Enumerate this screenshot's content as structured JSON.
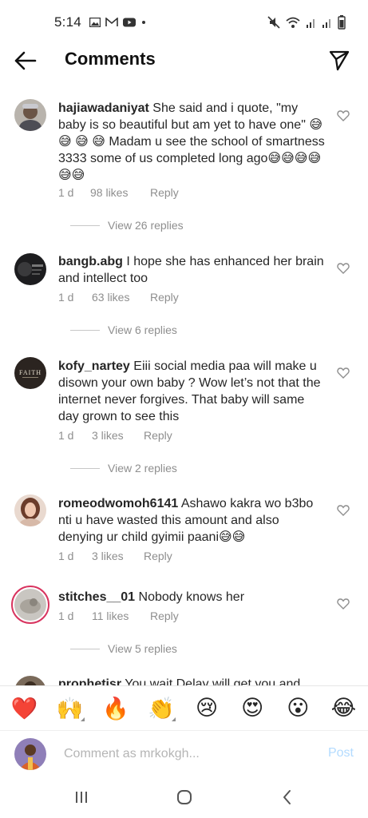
{
  "status_bar": {
    "time": "5:14",
    "left_icons": [
      "gallery-icon",
      "gmail-icon",
      "youtube-icon",
      "dot-icon"
    ],
    "right_icons": [
      "mute-icon",
      "wifi-icon",
      "signal-icon",
      "signal-icon",
      "battery-icon"
    ]
  },
  "header": {
    "title": "Comments",
    "back_icon": "arrow-left-icon",
    "send_icon": "send-icon"
  },
  "comments": [
    {
      "username": "hajiawadaniyat",
      "text": "She said and i quote, \"my baby is so beautiful but am yet to have one\" 😅 😅 😅 😅 Madam u see the school of smartness 3333 some of us completed long ago😅😅😅😅😅😅",
      "time": "1 d",
      "likes": "98 likes",
      "reply": "Reply",
      "view_replies": "View 26 replies"
    },
    {
      "username": "bangb.abg",
      "text": "I hope she has enhanced her brain and intellect too",
      "time": "1 d",
      "likes": "63 likes",
      "reply": "Reply",
      "view_replies": "View 6 replies"
    },
    {
      "username": "kofy_nartey",
      "text": "Eiii social media paa will make u disown your own baby ? Wow let’s not that the internet never forgives. That baby will same day grown to see this",
      "time": "1 d",
      "likes": "3 likes",
      "reply": "Reply",
      "view_replies": "View 2 replies"
    },
    {
      "username": "romeodwomoh6141",
      "text": "Ashawo kakra wo b3bo nti u have wasted this amount and also denying ur child gyimii paani😅😅",
      "time": "1 d",
      "likes": "3 likes",
      "reply": "Reply",
      "view_replies": ""
    },
    {
      "username": "stitches__01",
      "text": "Nobody knows her",
      "time": "1 d",
      "likes": "11 likes",
      "reply": "Reply",
      "view_replies": "View 5 replies"
    },
    {
      "username": "prophetisr",
      "text": "You wait Delay will get you and",
      "time": "",
      "likes": "",
      "reply": "",
      "view_replies": ""
    }
  ],
  "emoji_bar": [
    "❤️",
    "🙌",
    "🔥",
    "👏",
    "😢",
    "😍",
    "😮",
    "😂"
  ],
  "composer": {
    "placeholder": "Comment as mrkokgh...",
    "post_label": "Post"
  },
  "nav_bar": [
    "recent-apps-icon",
    "home-icon",
    "back-icon"
  ],
  "colors": {
    "text": "#262626",
    "muted": "#8e8e8e",
    "post_disabled": "#b3dbff",
    "heart": "#ed4956"
  }
}
